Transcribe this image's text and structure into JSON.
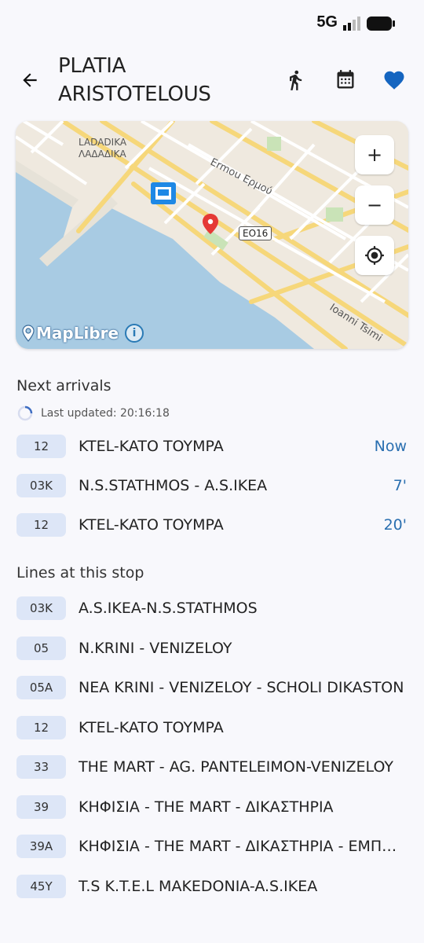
{
  "status": {
    "network": "5G"
  },
  "header": {
    "title": "PLATIA ARISTOTELOUS",
    "favorite_color": "#1565c0"
  },
  "map": {
    "district_en": "LADADIKA",
    "district_gr": "ΛΑΔΑΔΙΚΑ",
    "street_1": "Ermou Ερμού",
    "street_2": "Ioanni Tsimi",
    "route_shield": "ΕΟ16",
    "attribution": "MapLibre",
    "zoom_in": "+",
    "zoom_out": "−"
  },
  "arrivals": {
    "title": "Next arrivals",
    "last_updated": "Last updated: 20:16:18",
    "items": [
      {
        "line": "12",
        "name": "KTEL-KATO TOYMPA",
        "time": "Now"
      },
      {
        "line": "03K",
        "name": "N.S.STATHMOS - A.S.IKEA",
        "time": "7'"
      },
      {
        "line": "12",
        "name": "KTEL-KATO TOYMPA",
        "time": "20'"
      }
    ]
  },
  "lines": {
    "title": "Lines at this stop",
    "items": [
      {
        "line": "03K",
        "name": "A.S.IKEA-N.S.STATHMOS"
      },
      {
        "line": "05",
        "name": "N.KRINI - VENIZELOY"
      },
      {
        "line": "05A",
        "name": "NEA KRINI - VENIZELOY - SCHOLI DIKASTON"
      },
      {
        "line": "12",
        "name": "KTEL-KATO TOYMPA"
      },
      {
        "line": "33",
        "name": "THE MART - AG. PANTELEIMON-VENIZELOY"
      },
      {
        "line": "39",
        "name": "ΚΗΦΙΣΙΑ - THE MART - ΔΙΚΑΣΤΗΡΙΑ"
      },
      {
        "line": "39A",
        "name": "ΚΗΦΙΣΙΑ - THE MART - ΔΙΚΑΣΤΗΡΙΑ - ΕΜΠΟΡΙΟ"
      },
      {
        "line": "45Y",
        "name": "T.S K.T.E.L MAKEDONIA-A.S.IKEA"
      }
    ]
  }
}
